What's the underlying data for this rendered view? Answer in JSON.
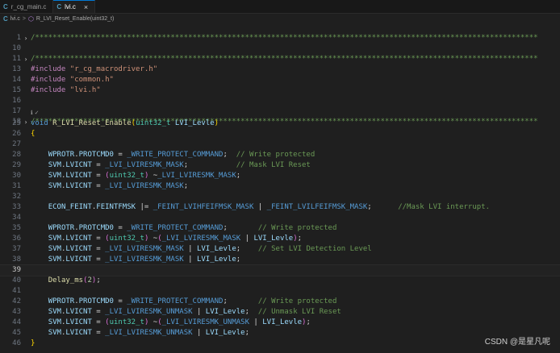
{
  "tabs": [
    {
      "icon": "C",
      "label": "r_cg_main.c",
      "active": false
    },
    {
      "icon": "C",
      "label": "lvi.c",
      "active": true,
      "close": "×"
    }
  ],
  "breadcrumb": {
    "file_icon": "C",
    "file": "lvi.c",
    "sep": ">",
    "func_icon": "⬡",
    "func": "R_LVI_Reset_Enable(uint32_t)"
  },
  "codelens": "ℹ ✓",
  "lines": {
    "l1": {
      "n": "1",
      "cm": "/*******************************************************************************************************************"
    },
    "l10": {
      "n": "10"
    },
    "l11": {
      "n": "11",
      "cm": "/*******************************************************************************************************************"
    },
    "l13": {
      "n": "13",
      "pp": "#include",
      "str": "\"r_cg_macrodriver.h\""
    },
    "l14": {
      "n": "14",
      "pp": "#include",
      "str": "\"common.h\""
    },
    "l15": {
      "n": "15",
      "pp": "#include",
      "str": "\"lvi.h\""
    },
    "l16": {
      "n": "16"
    },
    "l17": {
      "n": "17"
    },
    "l18": {
      "n": "18",
      "cm": "/*******************************************************************************************************************"
    },
    "l25": {
      "n": "25",
      "kw": "void",
      "fn": "R_LVI_Reset_Enable",
      "ty": "uint32_t",
      "var": "LVI_Levle"
    },
    "l26": {
      "n": "26"
    },
    "l27": {
      "n": "27"
    },
    "l28": {
      "n": "28",
      "cm": "// Write protected"
    },
    "l29": {
      "n": "29",
      "cm": "// Mask LVI Reset"
    },
    "l30": {
      "n": "30"
    },
    "l31": {
      "n": "31"
    },
    "l32": {
      "n": "32",
      "cm": "//Mask LVI interrupt."
    },
    "l33": {
      "n": "33"
    },
    "l34": {
      "n": "34",
      "cm": "// Write protected"
    },
    "l35": {
      "n": "35"
    },
    "l36": {
      "n": "36",
      "cm": "// Set LVI Detection Level"
    },
    "l37": {
      "n": "37"
    },
    "l38": {
      "n": "38"
    },
    "l39": {
      "n": "39",
      "fn": "Delay_ms",
      "num": "2"
    },
    "l40": {
      "n": "40"
    },
    "l41": {
      "n": "41",
      "cm": "// Write protected"
    },
    "l42": {
      "n": "42",
      "cm": "// Unmask LVI Reset"
    },
    "l43": {
      "n": "43"
    },
    "l44": {
      "n": "44"
    },
    "l45": {
      "n": "45"
    },
    "l46": {
      "n": "46"
    }
  },
  "tokens": {
    "wprotr": "WPROTR",
    "protcmd0": "PROTCMD0",
    "write_protect": "_WRITE_PROTECT_COMMAND",
    "svm": "SVM",
    "lvicnt": "LVICNT",
    "mask": "_LVI_LVIRESMK_MASK",
    "unmask": "_LVI_LVIRESMK_UNMASK",
    "uint32_t": "uint32_t",
    "levle": "LVI_Levle",
    "econ_feint": "ECON_FEINT",
    "feintfmsk": "FEINTFMSK",
    "lvih": "_FEINT_LVIHFEIFMSK_MASK",
    "lvil": "_FEINT_LVILFEIFMSK_MASK"
  },
  "watermark": "CSDN @是星凡呢"
}
